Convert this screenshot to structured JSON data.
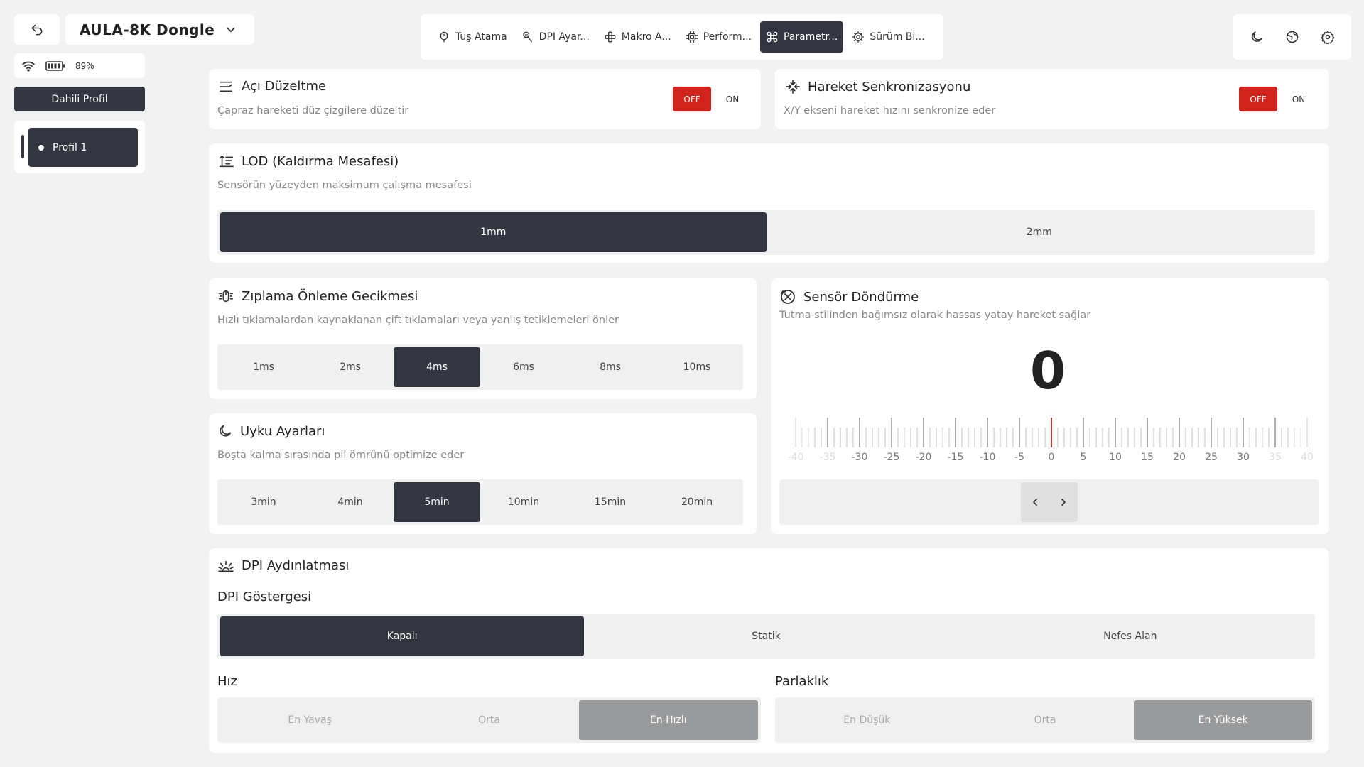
{
  "device": {
    "name": "AULA-8K Dongle",
    "battery": "89%"
  },
  "profiles": {
    "header": "Dahili Profil",
    "items": [
      {
        "label": "Profil 1"
      }
    ]
  },
  "tabs": [
    {
      "label": "Tuş Atama",
      "icon": "mouse-icon",
      "active": false
    },
    {
      "label": "DPI Ayar...",
      "icon": "dpi-icon",
      "active": false
    },
    {
      "label": "Makro A...",
      "icon": "macro-icon",
      "active": false
    },
    {
      "label": "Perform...",
      "icon": "chip-icon",
      "active": false
    },
    {
      "label": "Parametr...",
      "icon": "command-icon",
      "active": true
    },
    {
      "label": "Sürüm Bi...",
      "icon": "gear-icon",
      "active": false
    }
  ],
  "angle": {
    "title": "Açı Düzeltme",
    "desc": "Çapraz hareketi düz çizgilere düzeltir",
    "off": "OFF",
    "on": "ON"
  },
  "motion_sync": {
    "title": "Hareket Senkronizasyonu",
    "desc": "X/Y ekseni hareket hızını senkronize eder",
    "off": "OFF",
    "on": "ON"
  },
  "lod": {
    "title": "LOD (Kaldırma Mesafesi)",
    "desc": "Sensörün yüzeyden maksimum çalışma mesafesi",
    "options": [
      "1mm",
      "2mm"
    ],
    "selected": 0
  },
  "debounce": {
    "title": "Zıplama Önleme Gecikmesi",
    "desc": "Hızlı tıklamalardan kaynaklanan çift tıklamaları veya yanlış tetiklemeleri önler",
    "options": [
      "1ms",
      "2ms",
      "4ms",
      "6ms",
      "8ms",
      "10ms"
    ],
    "selected": 2
  },
  "sleep": {
    "title": "Uyku Ayarları",
    "desc": "Boşta kalma sırasında pil ömrünü optimize eder",
    "options": [
      "3min",
      "4min",
      "5min",
      "10min",
      "15min",
      "20min"
    ],
    "selected": 2
  },
  "rotation": {
    "title": "Sensör Döndürme",
    "desc": "Tutma stilinden bağımsız olarak hassas yatay hareket sağlar",
    "value": "0",
    "value_num": 0,
    "tick_labels": [
      "-40",
      "-35",
      "-30",
      "-25",
      "-20",
      "-15",
      "-10",
      "-5",
      "0",
      "5",
      "10",
      "15",
      "20",
      "25",
      "30",
      "35",
      "40"
    ]
  },
  "dpi_light": {
    "title": "DPI Aydınlatması",
    "indicator_label": "DPI Göstergesi",
    "indicator_options": [
      "Kapalı",
      "Statik",
      "Nefes Alan"
    ],
    "indicator_selected": 0,
    "speed_label": "Hız",
    "speed_options": [
      "En Yavaş",
      "Orta",
      "En Hızlı"
    ],
    "speed_selected": 2,
    "brightness_label": "Parlaklık",
    "brightness_options": [
      "En Düşük",
      "Orta",
      "En Yüksek"
    ],
    "brightness_selected": 2
  },
  "colors": {
    "dark": "#333640",
    "red": "#d2221c",
    "bg": "#f2f2f2"
  }
}
